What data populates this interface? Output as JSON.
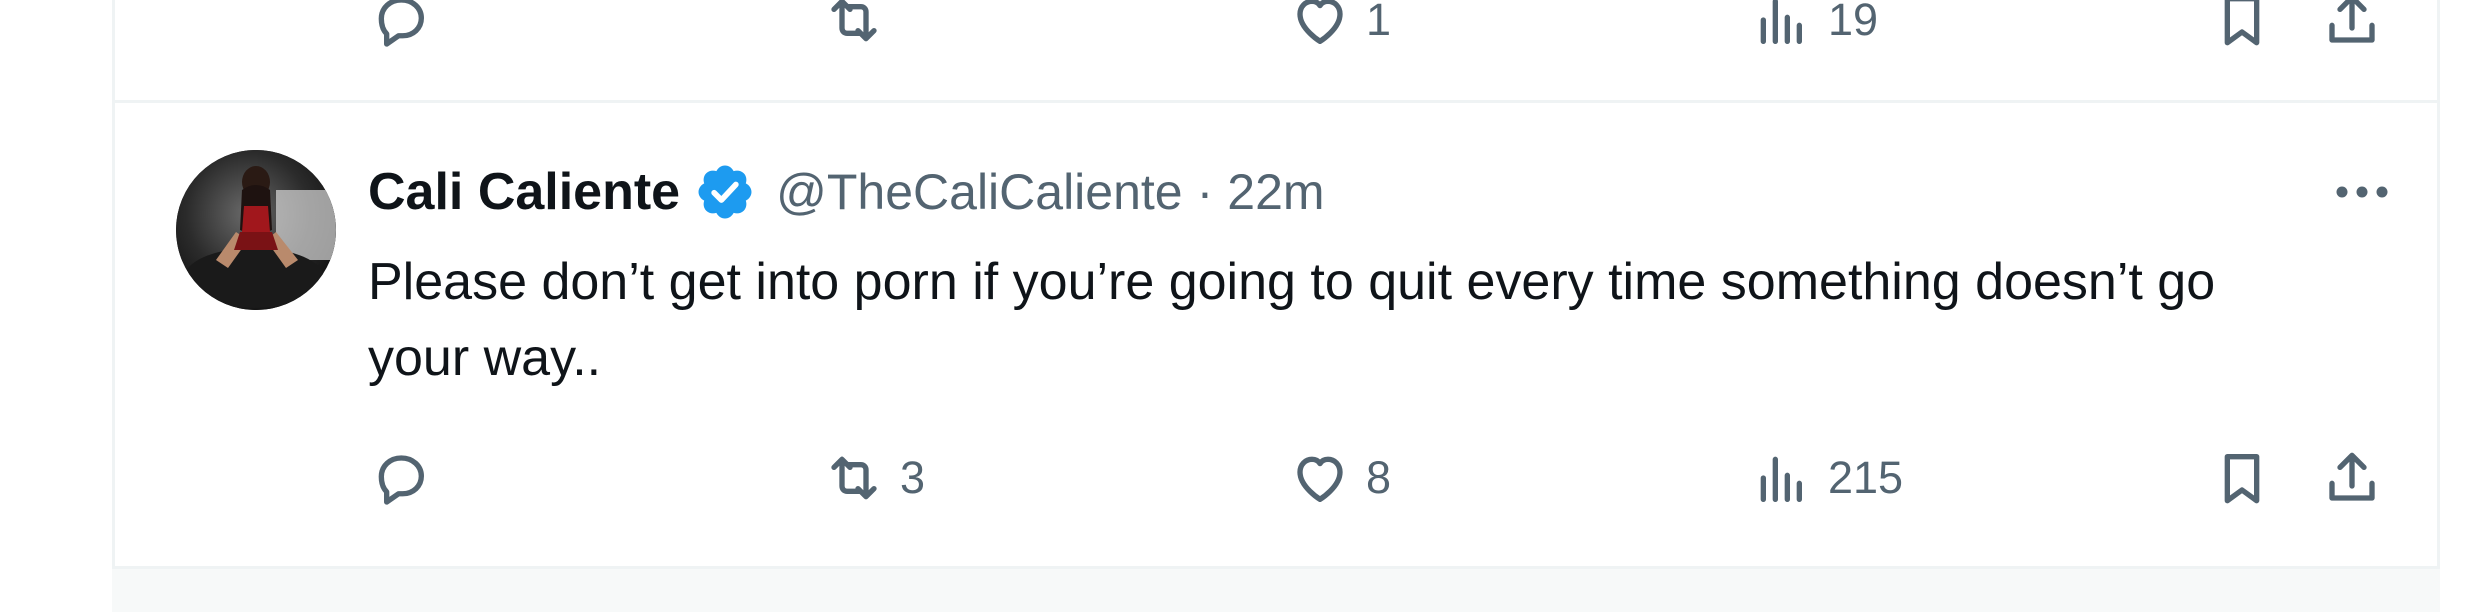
{
  "previous_tweet": {
    "actions": {
      "reply_count": "",
      "retweet_count": "",
      "like_count": "1",
      "view_count": "19"
    }
  },
  "tweet": {
    "display_name": "Cali Caliente",
    "handle": "@TheCaliCaliente",
    "separator": "·",
    "time": "22m",
    "text": "Please don’t get into porn if you’re going to quit every time something doesn’t go your way..",
    "actions": {
      "reply_count": "",
      "retweet_count": "3",
      "like_count": "8",
      "view_count": "215"
    }
  },
  "icons": [
    "reply-icon",
    "retweet-icon",
    "like-icon",
    "views-icon",
    "bookmark-icon",
    "share-icon",
    "verified-badge-icon",
    "more-icon"
  ],
  "colors": {
    "text_primary": "#0f1419",
    "text_secondary": "#536471",
    "verified_blue": "#1d9bf0",
    "border": "#eff3f4"
  }
}
